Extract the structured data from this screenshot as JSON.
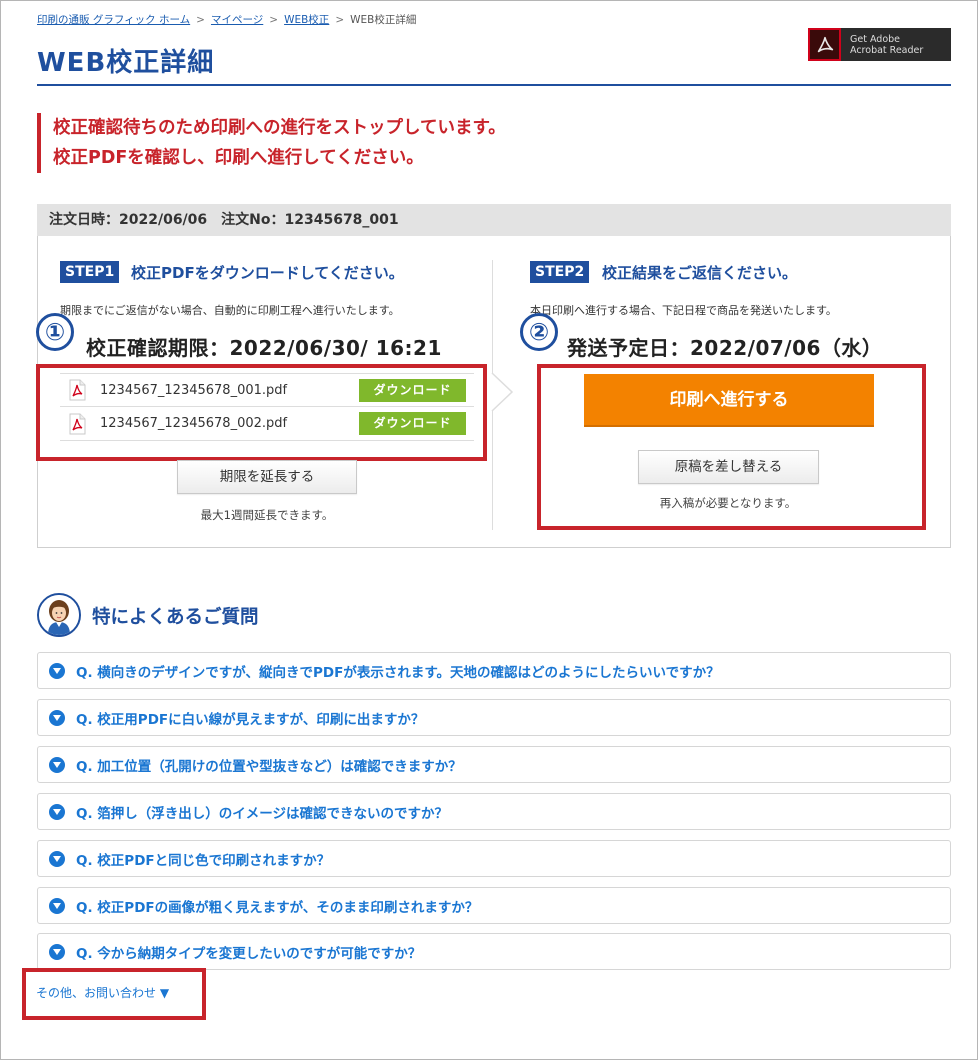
{
  "breadcrumb": {
    "items": [
      "印刷の通販 グラフィック ホーム",
      "マイページ",
      "WEB校正"
    ],
    "current": "WEB校正詳細",
    "separator": ">"
  },
  "page": {
    "title": "WEB校正詳細"
  },
  "acrobat": {
    "line1": "Get Adobe",
    "line2": "Acrobat Reader"
  },
  "alert": {
    "line1": "校正確認待ちのため印刷への進行をストップしています。",
    "line2": "校正PDFを確認し、印刷へ進行してください。"
  },
  "order": {
    "info": "注文日時：2022/06/06　注文No：12345678_001"
  },
  "step1": {
    "badge": "STEP1",
    "heading": "校正PDFをダウンロードしてください。",
    "note": "期限までにご返信がない場合、自動的に印刷工程へ進行いたします。",
    "marker": "①",
    "deadline": "校正確認期限：2022/06/30/ 16:21",
    "files": [
      {
        "name": "1234567_12345678_001.pdf",
        "button": "ダウンロード"
      },
      {
        "name": "1234567_12345678_002.pdf",
        "button": "ダウンロード"
      }
    ],
    "extend_button": "期限を延長する",
    "extend_note": "最大1週間延長できます。"
  },
  "step2": {
    "badge": "STEP2",
    "heading": "校正結果をご返信ください。",
    "note": "本日印刷へ進行する場合、下記日程で商品を発送いたします。",
    "marker": "②",
    "ship_date": "発送予定日：2022/07/06（水）",
    "proceed_button": "印刷へ進行する",
    "replace_button": "原稿を差し替える",
    "replace_note": "再入稿が必要となります。"
  },
  "faq": {
    "title": "特によくあるご質問",
    "items": [
      "Q. 横向きのデザインですが、縦向きでPDFが表示されます。天地の確認はどのようにしたらいいですか？",
      "Q. 校正用PDFに白い線が見えますが、印刷に出ますか？",
      "Q. 加工位置（孔開けの位置や型抜きなど）は確認できますか？",
      "Q. 箔押し（浮き出し）のイメージは確認できないのですか？",
      "Q. 校正PDFと同じ色で印刷されますか？",
      "Q. 校正PDFの画像が粗く見えますが、そのまま印刷されますか？",
      "Q. 今から納期タイプを変更したいのですが可能ですか？"
    ],
    "more_link": "その他、お問い合わせ ▼"
  },
  "colors": {
    "brand_blue": "#1f4f9e",
    "alert_red": "#c8242b",
    "proceed_orange": "#f38200",
    "download_green": "#80b82c",
    "faq_blue": "#1a76d2"
  }
}
